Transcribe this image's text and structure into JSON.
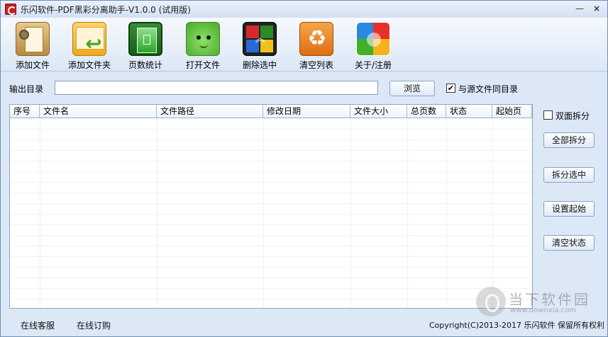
{
  "window": {
    "title": "乐闪软件-PDF黑彩分离助手-V1.0.0 (试用版)",
    "minimize_glyph": "—",
    "close_glyph": "×"
  },
  "toolbar": {
    "items": [
      {
        "label": "添加文件",
        "icon": "add-file-icon"
      },
      {
        "label": "添加文件夹",
        "icon": "add-folder-icon"
      },
      {
        "label": "页数统计",
        "icon": "page-count-icon"
      },
      {
        "label": "打开文件",
        "icon": "open-file-icon"
      },
      {
        "label": "删除选中",
        "icon": "delete-selected-icon"
      },
      {
        "label": "清空列表",
        "icon": "clear-list-icon"
      },
      {
        "label": "关于/注册",
        "icon": "about-register-icon"
      }
    ]
  },
  "output": {
    "label": "输出目录",
    "value": "",
    "browse_label": "浏览",
    "same_dir_label": "与源文件同目录",
    "same_dir_checked": true,
    "check_glyph": "✔"
  },
  "table": {
    "columns": [
      "序号",
      "文件名",
      "文件路径",
      "修改日期",
      "文件大小",
      "总页数",
      "状态",
      "起始页"
    ],
    "rows": []
  },
  "side": {
    "duplex_label": "双面拆分",
    "duplex_checked": false,
    "split_all_label": "全部拆分",
    "split_selected_label": "拆分选中",
    "set_start_label": "设置起始",
    "clear_status_label": "清空状态"
  },
  "footer": {
    "online_service": "在线客服",
    "online_order": "在线订购",
    "copyright": "Copyright(C)2013-2017 乐闪软件 保留所有权利"
  },
  "watermark": {
    "text": "当下软件园",
    "url": "www.downxia.com"
  }
}
